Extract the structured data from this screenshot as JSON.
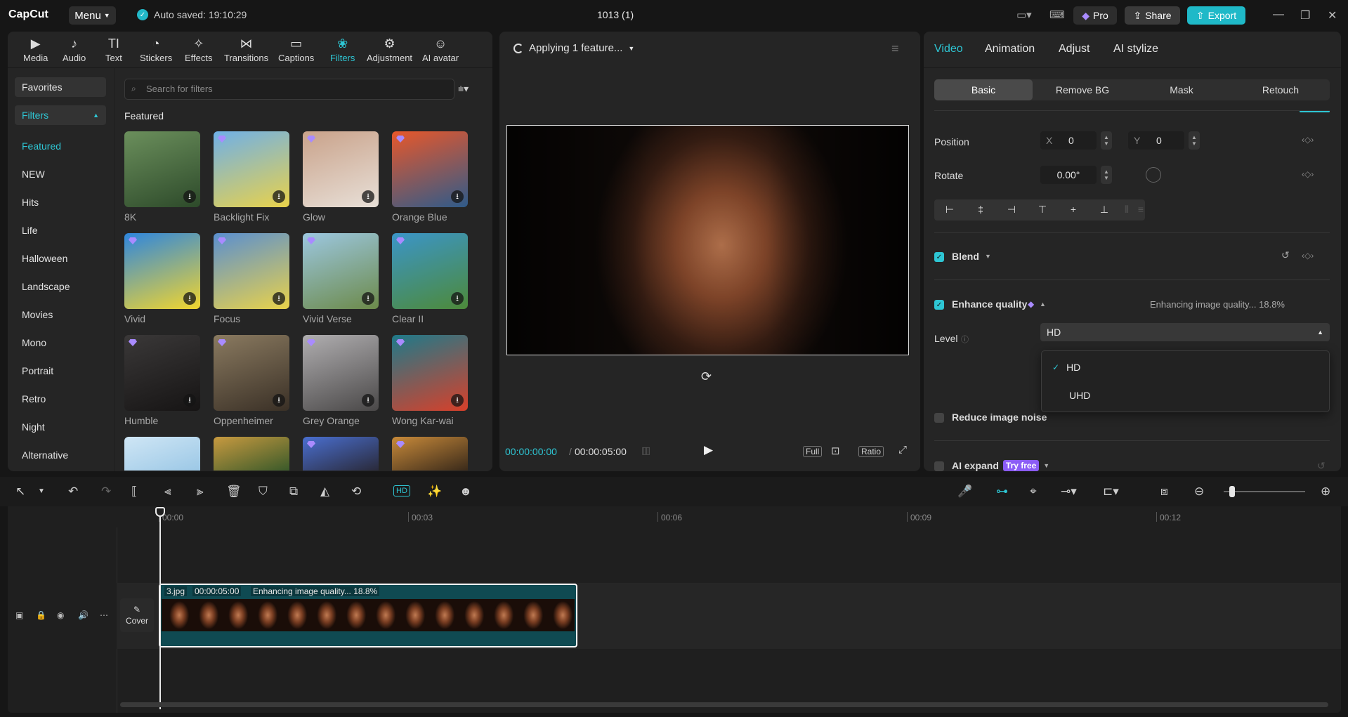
{
  "app": {
    "logo": "CapCut",
    "menu_label": "Menu",
    "autosave": "Auto saved: 19:10:29",
    "project_title": "1013 (1)",
    "pro_label": "Pro",
    "share_label": "Share",
    "export_label": "Export"
  },
  "tool_tabs": [
    {
      "label": "Media",
      "icon": "media-icon",
      "glyph": "▶"
    },
    {
      "label": "Audio",
      "icon": "audio-icon",
      "glyph": "♪"
    },
    {
      "label": "Text",
      "icon": "text-icon",
      "glyph": "TI"
    },
    {
      "label": "Stickers",
      "icon": "stickers-icon",
      "glyph": "◔"
    },
    {
      "label": "Effects",
      "icon": "effects-icon",
      "glyph": "✧"
    },
    {
      "label": "Transitions",
      "icon": "transitions-icon",
      "glyph": "⋈"
    },
    {
      "label": "Captions",
      "icon": "captions-icon",
      "glyph": "▭"
    },
    {
      "label": "Filters",
      "icon": "filters-icon",
      "glyph": "❀"
    },
    {
      "label": "Adjustment",
      "icon": "adjustment-icon",
      "glyph": "⚙"
    },
    {
      "label": "AI avatar",
      "icon": "ai-avatar-icon",
      "glyph": "☺"
    }
  ],
  "sidebar": {
    "favorites": "Favorites",
    "filters": "Filters",
    "items": [
      "Featured",
      "NEW",
      "Hits",
      "Life",
      "Halloween",
      "Landscape",
      "Movies",
      "Mono",
      "Portrait",
      "Retro",
      "Night",
      "Alternative"
    ]
  },
  "search": {
    "placeholder": "Search for filters"
  },
  "featured_title": "Featured",
  "filters": [
    {
      "label": "8K",
      "c1": "#6b8f5c",
      "c2": "#2d4a2a"
    },
    {
      "label": "Backlight Fix",
      "c1": "#6fb0e8",
      "c2": "#e9d24a"
    },
    {
      "label": "Glow",
      "c1": "#c9a28a",
      "c2": "#e8e0d8"
    },
    {
      "label": "Orange Blue",
      "c1": "#e8572a",
      "c2": "#2f5b8a"
    },
    {
      "label": "Vivid",
      "c1": "#2e86de",
      "c2": "#f2d62e"
    },
    {
      "label": "Focus",
      "c1": "#5a8fd0",
      "c2": "#e9d24a"
    },
    {
      "label": "Vivid Verse",
      "c1": "#9cc7e0",
      "c2": "#6c8a4a"
    },
    {
      "label": "Clear II",
      "c1": "#3b95c8",
      "c2": "#4d8a3a"
    },
    {
      "label": "Humble",
      "c1": "#3a3838",
      "c2": "#161414"
    },
    {
      "label": "Oppenheimer",
      "c1": "#8a7a60",
      "c2": "#3a3026"
    },
    {
      "label": "Grey Orange",
      "c1": "#b0aeb0",
      "c2": "#4a4848"
    },
    {
      "label": "Wong Kar-wai",
      "c1": "#1e7a8a",
      "c2": "#d8402a"
    },
    {
      "label": "",
      "c1": "#cfe6f5",
      "c2": "#9cc8e6"
    },
    {
      "label": "",
      "c1": "#c89a40",
      "c2": "#3a5a2a"
    },
    {
      "label": "",
      "c1": "#4a6fd0",
      "c2": "#2a2a3a"
    },
    {
      "label": "",
      "c1": "#c88a3a",
      "c2": "#3a2a1a"
    }
  ],
  "player": {
    "status": "Applying 1 feature...",
    "current_time": "00:00:00:00",
    "duration": "00:00:05:00",
    "full": "Full",
    "ratio": "Ratio"
  },
  "inspector": {
    "tabs": [
      "Video",
      "Animation",
      "Adjust",
      "AI stylize"
    ],
    "sub_tabs": [
      "Basic",
      "Remove BG",
      "Mask",
      "Retouch"
    ],
    "position_label": "Position",
    "x_label": "X",
    "x_value": "0",
    "y_label": "Y",
    "y_value": "0",
    "rotate_label": "Rotate",
    "rotate_value": "0.00°",
    "blend_label": "Blend",
    "enhance_label": "Enhance quality",
    "enhance_status": "Enhancing image quality... 18.8%",
    "level_label": "Level",
    "level_value": "HD",
    "level_options": [
      "HD",
      "UHD"
    ],
    "reduce_noise_label": "Reduce image noise",
    "ai_expand_label": "AI expand",
    "try_free": "Try free"
  },
  "timeline": {
    "ruler": [
      "00:00",
      "00:03",
      "00:06",
      "00:09",
      "00:12"
    ],
    "clip_name": "3.jpg",
    "clip_duration": "00:00:05:00",
    "clip_status": "Enhancing image quality... 18.8%",
    "cover_label": "Cover"
  }
}
